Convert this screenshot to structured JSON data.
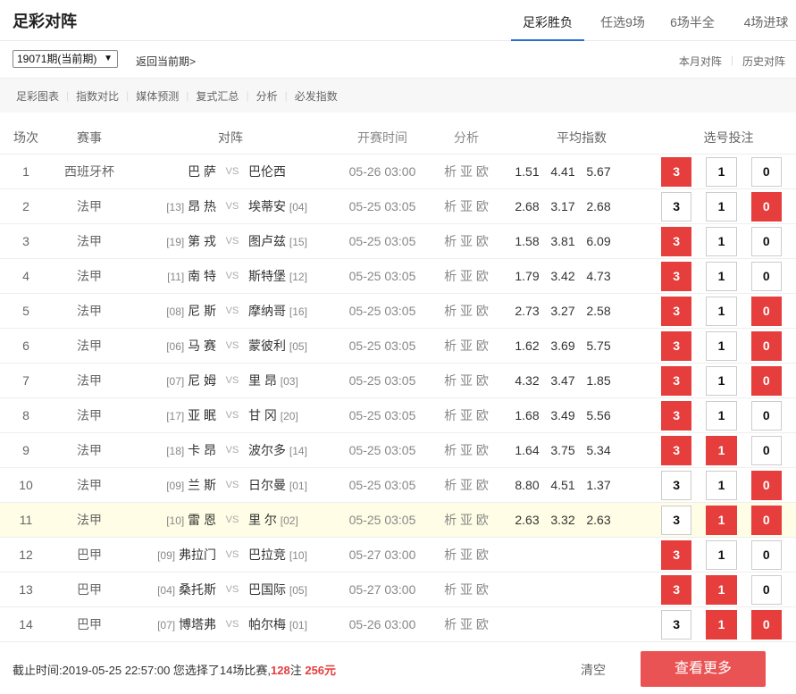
{
  "header": {
    "title": "足彩对阵",
    "tabs": [
      "足彩胜负",
      "任选9场",
      "6场半全",
      "4场进球"
    ],
    "active_tab": 0
  },
  "toolbar": {
    "period_select": "19071期(当前期)",
    "back_link": "返回当前期>",
    "month_link": "本月对阵",
    "history_link": "历史对阵"
  },
  "subnav": [
    "足彩图表",
    "指数对比",
    "媒体预测",
    "复式汇总",
    "分析",
    "必发指数"
  ],
  "table": {
    "headers": {
      "no": "场次",
      "league": "赛事",
      "match": "对阵",
      "time": "开赛时间",
      "analysis": "分析",
      "odds": "平均指数",
      "bets": "选号投注"
    },
    "rows": [
      {
        "no": "1",
        "league": "西班牙杯",
        "home_rank": "",
        "home": "巴 萨",
        "vs": "VS",
        "away": "巴伦西",
        "away_rank": "",
        "time": "05-26 03:00",
        "analysis": "析 亚 欧",
        "odds": [
          "1.51",
          "4.41",
          "5.67"
        ],
        "bets": [
          "3",
          "1",
          "0"
        ],
        "selected": [
          true,
          false,
          false
        ],
        "highlight": false
      },
      {
        "no": "2",
        "league": "法甲",
        "home_rank": "[13]",
        "home": "昂 热",
        "vs": "VS",
        "away": "埃蒂安",
        "away_rank": "[04]",
        "time": "05-25 03:05",
        "analysis": "析 亚 欧",
        "odds": [
          "2.68",
          "3.17",
          "2.68"
        ],
        "bets": [
          "3",
          "1",
          "0"
        ],
        "selected": [
          false,
          false,
          true
        ],
        "highlight": false
      },
      {
        "no": "3",
        "league": "法甲",
        "home_rank": "[19]",
        "home": "第 戎",
        "vs": "VS",
        "away": "图卢兹",
        "away_rank": "[15]",
        "time": "05-25 03:05",
        "analysis": "析 亚 欧",
        "odds": [
          "1.58",
          "3.81",
          "6.09"
        ],
        "bets": [
          "3",
          "1",
          "0"
        ],
        "selected": [
          true,
          false,
          false
        ],
        "highlight": false
      },
      {
        "no": "4",
        "league": "法甲",
        "home_rank": "[11]",
        "home": "南 特",
        "vs": "VS",
        "away": "斯特堡",
        "away_rank": "[12]",
        "time": "05-25 03:05",
        "analysis": "析 亚 欧",
        "odds": [
          "1.79",
          "3.42",
          "4.73"
        ],
        "bets": [
          "3",
          "1",
          "0"
        ],
        "selected": [
          true,
          false,
          false
        ],
        "highlight": false
      },
      {
        "no": "5",
        "league": "法甲",
        "home_rank": "[08]",
        "home": "尼 斯",
        "vs": "VS",
        "away": "摩纳哥",
        "away_rank": "[16]",
        "time": "05-25 03:05",
        "analysis": "析 亚 欧",
        "odds": [
          "2.73",
          "3.27",
          "2.58"
        ],
        "bets": [
          "3",
          "1",
          "0"
        ],
        "selected": [
          true,
          false,
          true
        ],
        "highlight": false
      },
      {
        "no": "6",
        "league": "法甲",
        "home_rank": "[06]",
        "home": "马 赛",
        "vs": "VS",
        "away": "蒙彼利",
        "away_rank": "[05]",
        "time": "05-25 03:05",
        "analysis": "析 亚 欧",
        "odds": [
          "1.62",
          "3.69",
          "5.75"
        ],
        "bets": [
          "3",
          "1",
          "0"
        ],
        "selected": [
          true,
          false,
          true
        ],
        "highlight": false
      },
      {
        "no": "7",
        "league": "法甲",
        "home_rank": "[07]",
        "home": "尼 姆",
        "vs": "VS",
        "away": "里 昂",
        "away_rank": "[03]",
        "time": "05-25 03:05",
        "analysis": "析 亚 欧",
        "odds": [
          "4.32",
          "3.47",
          "1.85"
        ],
        "bets": [
          "3",
          "1",
          "0"
        ],
        "selected": [
          true,
          false,
          true
        ],
        "highlight": false
      },
      {
        "no": "8",
        "league": "法甲",
        "home_rank": "[17]",
        "home": "亚 眠",
        "vs": "VS",
        "away": "甘 冈",
        "away_rank": "[20]",
        "time": "05-25 03:05",
        "analysis": "析 亚 欧",
        "odds": [
          "1.68",
          "3.49",
          "5.56"
        ],
        "bets": [
          "3",
          "1",
          "0"
        ],
        "selected": [
          true,
          false,
          false
        ],
        "highlight": false
      },
      {
        "no": "9",
        "league": "法甲",
        "home_rank": "[18]",
        "home": "卡 昂",
        "vs": "VS",
        "away": "波尔多",
        "away_rank": "[14]",
        "time": "05-25 03:05",
        "analysis": "析 亚 欧",
        "odds": [
          "1.64",
          "3.75",
          "5.34"
        ],
        "bets": [
          "3",
          "1",
          "0"
        ],
        "selected": [
          true,
          true,
          false
        ],
        "highlight": false
      },
      {
        "no": "10",
        "league": "法甲",
        "home_rank": "[09]",
        "home": "兰 斯",
        "vs": "VS",
        "away": "日尔曼",
        "away_rank": "[01]",
        "time": "05-25 03:05",
        "analysis": "析 亚 欧",
        "odds": [
          "8.80",
          "4.51",
          "1.37"
        ],
        "bets": [
          "3",
          "1",
          "0"
        ],
        "selected": [
          false,
          false,
          true
        ],
        "highlight": false
      },
      {
        "no": "11",
        "league": "法甲",
        "home_rank": "[10]",
        "home": "雷 恩",
        "vs": "VS",
        "away": "里 尔",
        "away_rank": "[02]",
        "time": "05-25 03:05",
        "analysis": "析 亚 欧",
        "odds": [
          "2.63",
          "3.32",
          "2.63"
        ],
        "bets": [
          "3",
          "1",
          "0"
        ],
        "selected": [
          false,
          true,
          true
        ],
        "highlight": true
      },
      {
        "no": "12",
        "league": "巴甲",
        "home_rank": "[09]",
        "home": "弗拉门",
        "vs": "VS",
        "away": "巴拉竞",
        "away_rank": "[10]",
        "time": "05-27 03:00",
        "analysis": "析 亚 欧",
        "odds": [
          "",
          "",
          ""
        ],
        "bets": [
          "3",
          "1",
          "0"
        ],
        "selected": [
          true,
          false,
          false
        ],
        "highlight": false
      },
      {
        "no": "13",
        "league": "巴甲",
        "home_rank": "[04]",
        "home": "桑托斯",
        "vs": "VS",
        "away": "巴国际",
        "away_rank": "[05]",
        "time": "05-27 03:00",
        "analysis": "析 亚 欧",
        "odds": [
          "",
          "",
          ""
        ],
        "bets": [
          "3",
          "1",
          "0"
        ],
        "selected": [
          true,
          true,
          false
        ],
        "highlight": false
      },
      {
        "no": "14",
        "league": "巴甲",
        "home_rank": "[07]",
        "home": "博塔弗",
        "vs": "VS",
        "away": "帕尔梅",
        "away_rank": "[01]",
        "time": "05-26 03:00",
        "analysis": "析 亚 欧",
        "odds": [
          "",
          "",
          ""
        ],
        "bets": [
          "3",
          "1",
          "0"
        ],
        "selected": [
          false,
          true,
          true
        ],
        "highlight": false
      }
    ]
  },
  "footer": {
    "summary_prefix": "截止时间:2019-05-25 22:57:00 您选择了14场比赛,",
    "bet_count": "128",
    "bet_unit": "注 ",
    "amount": "256元",
    "clear_label": "清空",
    "more_label": "查看更多"
  },
  "colors": {
    "accent_red": "#e63d3d",
    "tab_underline": "#2a6fd4",
    "highlight_row": "#fffde6"
  }
}
